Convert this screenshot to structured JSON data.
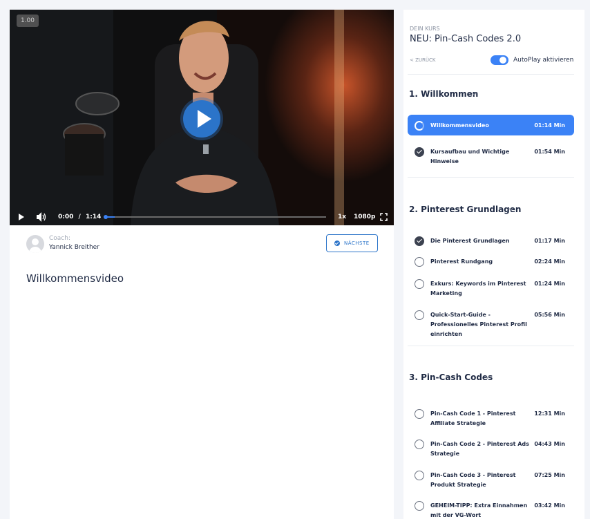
{
  "video": {
    "speed_badge": "1.00",
    "current_time": "0:00",
    "time_separator": "/",
    "duration": "1:14",
    "progress": 0.05,
    "playback_rate": "1x",
    "quality": "1080p"
  },
  "coach": {
    "label": "Coach:",
    "name": "Yannick Breither"
  },
  "next_button": "NÄCHSTE",
  "lesson_title": "Willkommensvideo",
  "sidebar": {
    "kicker": "DEIN KURS",
    "course_title": "NEU: Pin-Cash Codes 2.0",
    "back_label": "< ZURÜCK",
    "autoplay_label": "AutoPlay aktivieren",
    "autoplay_on": true
  },
  "sections": [
    {
      "title": "1. Willkommen",
      "lessons": [
        {
          "name": "Willkommensvideo",
          "duration": "01:14 Min",
          "status": "current"
        },
        {
          "name": "Kursaufbau und Wichtige Hinweise",
          "duration": "01:54 Min",
          "status": "done"
        }
      ]
    },
    {
      "title": "2. Pinterest Grundlagen",
      "lessons": [
        {
          "name": "Die Pinterest Grundlagen",
          "duration": "01:17 Min",
          "status": "done"
        },
        {
          "name": "Pinterest Rundgang",
          "duration": "02:24 Min",
          "status": "open"
        },
        {
          "name": "Exkurs: Keywords im Pinterest Marketing",
          "duration": "01:24 Min",
          "status": "open"
        },
        {
          "name": "Quick-Start-Guide - Professionelles Pinterest Profil einrichten",
          "duration": "05:56 Min",
          "status": "open"
        }
      ]
    },
    {
      "title": "3. Pin-Cash Codes",
      "lessons": [
        {
          "name": "Pin-Cash Code 1 - Pinterest Affiliate Strategie",
          "duration": "12:31 Min",
          "status": "open"
        },
        {
          "name": "Pin-Cash Code 2 - Pinterest Ads Strategie",
          "duration": "04:43 Min",
          "status": "open"
        },
        {
          "name": "Pin-Cash Code 3 - Pinterest Produkt Strategie",
          "duration": "07:25 Min",
          "status": "open"
        },
        {
          "name": "GEHEIM-TIPP: Extra Einnahmen mit der VG-Wort",
          "duration": "03:42 Min",
          "status": "open"
        }
      ]
    }
  ],
  "colors": {
    "accent": "#3b82f6",
    "play_button": "#2b74c9",
    "text": "#1f2a44"
  }
}
